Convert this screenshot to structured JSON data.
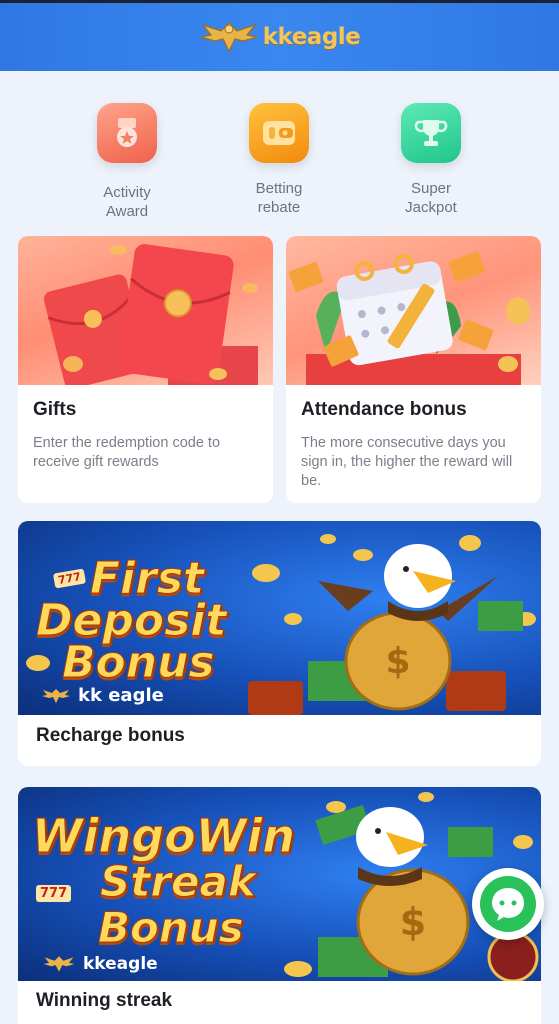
{
  "header": {
    "brand": "kkeagle"
  },
  "quick_menu": [
    {
      "label": "Activity\nAward",
      "icon": "medal-icon",
      "color": "#f37a60"
    },
    {
      "label": "Betting\nrebate",
      "icon": "wallet-icon",
      "color": "#f59b1c"
    },
    {
      "label": "Super\nJackpot",
      "icon": "trophy-icon",
      "color": "#2fd39a"
    }
  ],
  "cards": {
    "gifts": {
      "title": "Gifts",
      "desc": "Enter the redemption code to receive gift rewards"
    },
    "attendance": {
      "title": "Attendance bonus",
      "desc": "The more consecutive days you sign in, the higher the reward will be."
    },
    "recharge": {
      "title": "Recharge bonus",
      "banner_line1": "First",
      "banner_line2": "Deposit",
      "banner_line3": "Bonus",
      "banner_brand": "kk eagle",
      "banner_badge": "777"
    },
    "streak": {
      "title": "Winning streak",
      "banner_line1": "WingoWin",
      "banner_line2": "Streak",
      "banner_line3": "Bonus",
      "banner_brand": "kkeagle",
      "banner_badge": "777"
    }
  }
}
